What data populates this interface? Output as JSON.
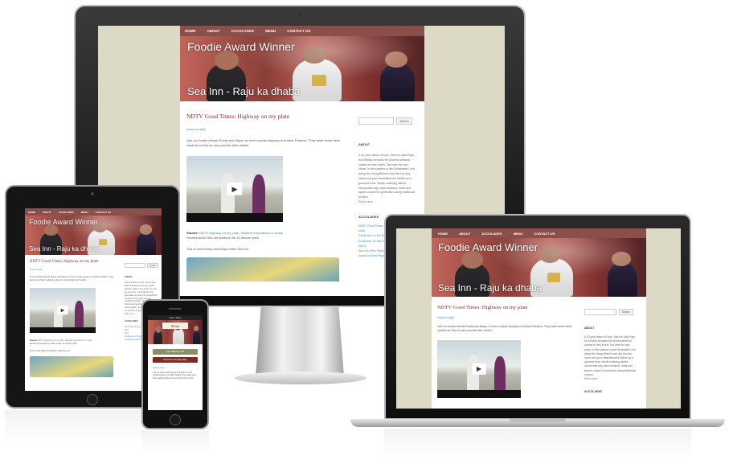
{
  "site": {
    "nav": [
      "HOME",
      "ABOUT",
      "ACCOLADES",
      "MENU",
      "CONTACT US"
    ],
    "banner_title": "Foodie Award Winner",
    "banner_subtitle": "Sea Inn - Raju ka dhaba",
    "post_title": "NDTV Good Times: Highway on my plate",
    "leave_reply": "Leave a reply",
    "intro": "Join our foodie friends Rocky and Mayur on their coastal odyssey in Andhra Pradesh. They taste some fresh seafood at Sea Inn and provide their verdict.",
    "source_label": "Source:",
    "source_link": "NDTV Highway on my plate: Seaside explorations in Araku",
    "source_text": "Review about Sea Inn starts at the 10 minute mark.",
    "rocky_line": "This is how Rocky and Mayur rated Sea Inn",
    "search_button": "Search",
    "about_heading": "ABOUT",
    "about_text": "A 20-year labour of love, Sea Inn (aka Raju Ka Dhaba) elevates the Andhra seafood cuisine to new levels. Set near the sea-shore, in the shadow of the Illuminated Lord along the Vizag-Bhimili road this low-key haunt and your establishment dishes up a gourmet treat. Mouth watering dishes incorporate day catch seafood, meat and spices cooked to perfection using traditional recipes.",
    "read_more": "Read more →",
    "accolades_heading": "ACCOLADES",
    "accolade_links": [
      "NDTV Good Times - Highway on my plate",
      "India",
      "FoodLinks on the Road",
      "FoodLinks on Wiz Trip",
      "NDTV",
      "Sea Inn Wins Times Food",
      "Award for Best Regional"
    ]
  },
  "phone": {
    "status": "Raju's dhaba",
    "menu_label": "Menu",
    "call_button": "Call: 0989 812 560",
    "directions_button": "Directions (Google Map)"
  },
  "colors": {
    "nav": "#8a4f4b",
    "title": "#8a2f2a",
    "link": "#3c8fd0",
    "call": "#8c8d6b",
    "directions": "#7c2a26"
  }
}
